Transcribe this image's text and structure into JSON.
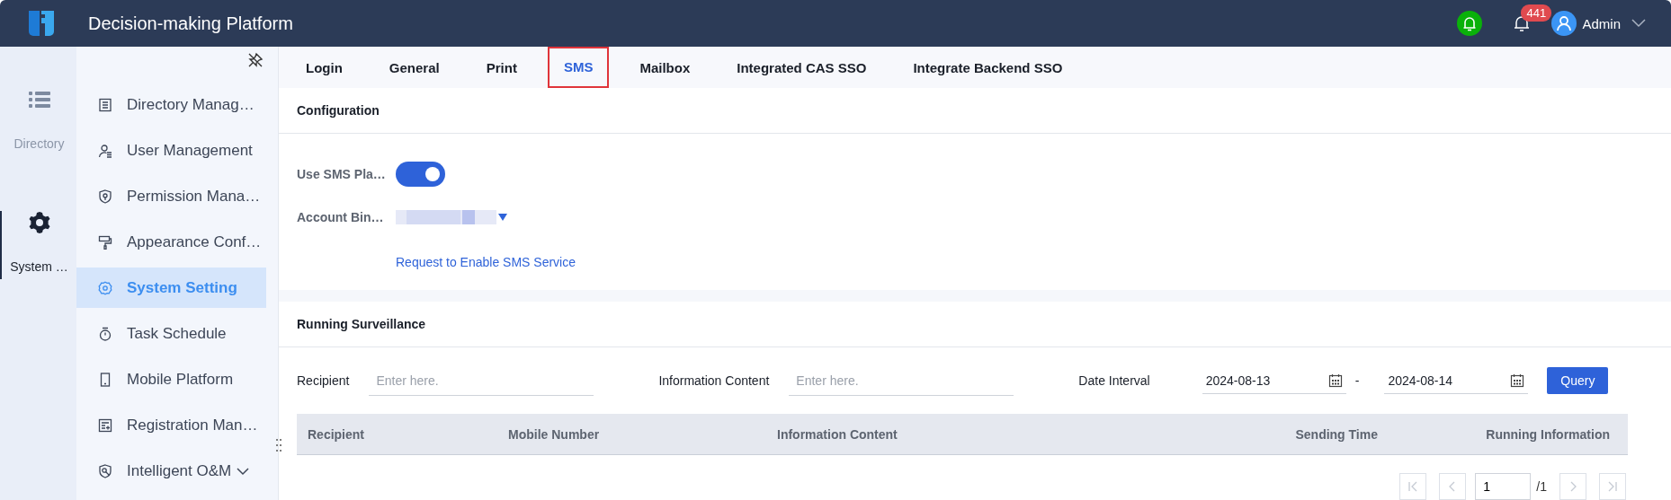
{
  "header": {
    "title": "Decision-making Platform",
    "notification_count": "441",
    "user": "Admin"
  },
  "rail": [
    {
      "label": "Directory",
      "selected": false
    },
    {
      "label": "System …",
      "selected": true
    }
  ],
  "menu": [
    {
      "label": "Directory Manag…",
      "selected": false
    },
    {
      "label": "User Management",
      "selected": false
    },
    {
      "label": "Permission Mana…",
      "selected": false
    },
    {
      "label": "Appearance Conf…",
      "selected": false
    },
    {
      "label": "System Setting",
      "selected": true
    },
    {
      "label": "Task Schedule",
      "selected": false
    },
    {
      "label": "Mobile Platform",
      "selected": false
    },
    {
      "label": "Registration Man…",
      "selected": false
    },
    {
      "label": "Intelligent O&M",
      "selected": false,
      "expanded": false
    }
  ],
  "tabs": [
    {
      "label": "Login",
      "selected": false
    },
    {
      "label": "General",
      "selected": false
    },
    {
      "label": "Print",
      "selected": false
    },
    {
      "label": "SMS",
      "selected": true,
      "highlighted": true
    },
    {
      "label": "Mailbox",
      "selected": false
    },
    {
      "label": "Integrated CAS SSO",
      "selected": false
    },
    {
      "label": "Integrate Backend SSO",
      "selected": false
    }
  ],
  "configuration": {
    "title": "Configuration",
    "use_sms_label": "Use SMS Pla…",
    "use_sms_on": true,
    "account_label": "Account Bin…",
    "link": "Request to Enable SMS Service"
  },
  "surveillance": {
    "title": "Running Surveillance",
    "filters": [
      {
        "kind": "text",
        "label": "Recipient",
        "placeholder": "Enter here."
      },
      {
        "kind": "text",
        "label": "Information Content",
        "placeholder": "Enter here."
      },
      {
        "kind": "dates",
        "label": "Date Interval",
        "from": "2024-08-13",
        "separator": "-",
        "to": "2024-08-14"
      }
    ],
    "query_button": "Query",
    "table": {
      "columns": [
        "Recipient",
        "Mobile Number",
        "Information Content",
        "Sending Time",
        "Running Information"
      ]
    },
    "pagination": {
      "page": "1",
      "total": "/1"
    }
  }
}
